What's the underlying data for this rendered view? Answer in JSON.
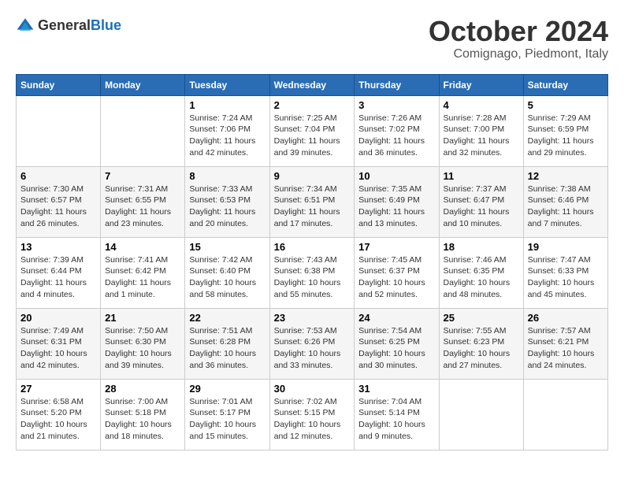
{
  "logo": {
    "text_general": "General",
    "text_blue": "Blue"
  },
  "title": {
    "month_year": "October 2024",
    "location": "Comignago, Piedmont, Italy"
  },
  "header_days": [
    "Sunday",
    "Monday",
    "Tuesday",
    "Wednesday",
    "Thursday",
    "Friday",
    "Saturday"
  ],
  "weeks": [
    [
      {
        "day": "",
        "info": ""
      },
      {
        "day": "",
        "info": ""
      },
      {
        "day": "1",
        "info": "Sunrise: 7:24 AM\nSunset: 7:06 PM\nDaylight: 11 hours and 42 minutes."
      },
      {
        "day": "2",
        "info": "Sunrise: 7:25 AM\nSunset: 7:04 PM\nDaylight: 11 hours and 39 minutes."
      },
      {
        "day": "3",
        "info": "Sunrise: 7:26 AM\nSunset: 7:02 PM\nDaylight: 11 hours and 36 minutes."
      },
      {
        "day": "4",
        "info": "Sunrise: 7:28 AM\nSunset: 7:00 PM\nDaylight: 11 hours and 32 minutes."
      },
      {
        "day": "5",
        "info": "Sunrise: 7:29 AM\nSunset: 6:59 PM\nDaylight: 11 hours and 29 minutes."
      }
    ],
    [
      {
        "day": "6",
        "info": "Sunrise: 7:30 AM\nSunset: 6:57 PM\nDaylight: 11 hours and 26 minutes."
      },
      {
        "day": "7",
        "info": "Sunrise: 7:31 AM\nSunset: 6:55 PM\nDaylight: 11 hours and 23 minutes."
      },
      {
        "day": "8",
        "info": "Sunrise: 7:33 AM\nSunset: 6:53 PM\nDaylight: 11 hours and 20 minutes."
      },
      {
        "day": "9",
        "info": "Sunrise: 7:34 AM\nSunset: 6:51 PM\nDaylight: 11 hours and 17 minutes."
      },
      {
        "day": "10",
        "info": "Sunrise: 7:35 AM\nSunset: 6:49 PM\nDaylight: 11 hours and 13 minutes."
      },
      {
        "day": "11",
        "info": "Sunrise: 7:37 AM\nSunset: 6:47 PM\nDaylight: 11 hours and 10 minutes."
      },
      {
        "day": "12",
        "info": "Sunrise: 7:38 AM\nSunset: 6:46 PM\nDaylight: 11 hours and 7 minutes."
      }
    ],
    [
      {
        "day": "13",
        "info": "Sunrise: 7:39 AM\nSunset: 6:44 PM\nDaylight: 11 hours and 4 minutes."
      },
      {
        "day": "14",
        "info": "Sunrise: 7:41 AM\nSunset: 6:42 PM\nDaylight: 11 hours and 1 minute."
      },
      {
        "day": "15",
        "info": "Sunrise: 7:42 AM\nSunset: 6:40 PM\nDaylight: 10 hours and 58 minutes."
      },
      {
        "day": "16",
        "info": "Sunrise: 7:43 AM\nSunset: 6:38 PM\nDaylight: 10 hours and 55 minutes."
      },
      {
        "day": "17",
        "info": "Sunrise: 7:45 AM\nSunset: 6:37 PM\nDaylight: 10 hours and 52 minutes."
      },
      {
        "day": "18",
        "info": "Sunrise: 7:46 AM\nSunset: 6:35 PM\nDaylight: 10 hours and 48 minutes."
      },
      {
        "day": "19",
        "info": "Sunrise: 7:47 AM\nSunset: 6:33 PM\nDaylight: 10 hours and 45 minutes."
      }
    ],
    [
      {
        "day": "20",
        "info": "Sunrise: 7:49 AM\nSunset: 6:31 PM\nDaylight: 10 hours and 42 minutes."
      },
      {
        "day": "21",
        "info": "Sunrise: 7:50 AM\nSunset: 6:30 PM\nDaylight: 10 hours and 39 minutes."
      },
      {
        "day": "22",
        "info": "Sunrise: 7:51 AM\nSunset: 6:28 PM\nDaylight: 10 hours and 36 minutes."
      },
      {
        "day": "23",
        "info": "Sunrise: 7:53 AM\nSunset: 6:26 PM\nDaylight: 10 hours and 33 minutes."
      },
      {
        "day": "24",
        "info": "Sunrise: 7:54 AM\nSunset: 6:25 PM\nDaylight: 10 hours and 30 minutes."
      },
      {
        "day": "25",
        "info": "Sunrise: 7:55 AM\nSunset: 6:23 PM\nDaylight: 10 hours and 27 minutes."
      },
      {
        "day": "26",
        "info": "Sunrise: 7:57 AM\nSunset: 6:21 PM\nDaylight: 10 hours and 24 minutes."
      }
    ],
    [
      {
        "day": "27",
        "info": "Sunrise: 6:58 AM\nSunset: 5:20 PM\nDaylight: 10 hours and 21 minutes."
      },
      {
        "day": "28",
        "info": "Sunrise: 7:00 AM\nSunset: 5:18 PM\nDaylight: 10 hours and 18 minutes."
      },
      {
        "day": "29",
        "info": "Sunrise: 7:01 AM\nSunset: 5:17 PM\nDaylight: 10 hours and 15 minutes."
      },
      {
        "day": "30",
        "info": "Sunrise: 7:02 AM\nSunset: 5:15 PM\nDaylight: 10 hours and 12 minutes."
      },
      {
        "day": "31",
        "info": "Sunrise: 7:04 AM\nSunset: 5:14 PM\nDaylight: 10 hours and 9 minutes."
      },
      {
        "day": "",
        "info": ""
      },
      {
        "day": "",
        "info": ""
      }
    ]
  ]
}
